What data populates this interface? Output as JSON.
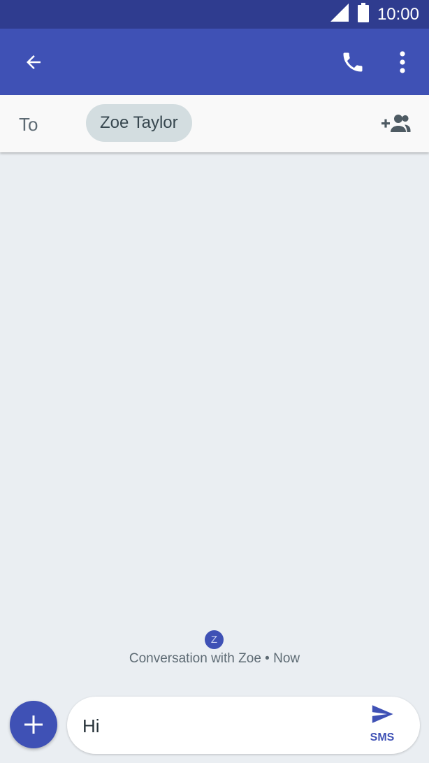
{
  "status_bar": {
    "time": "10:00",
    "signal_icon": "signal-icon",
    "battery_icon": "battery-icon"
  },
  "app_bar": {
    "background": "#3f51b5",
    "back_icon": "arrow-back-icon",
    "call_icon": "phone-icon",
    "menu_icon": "more-vert-icon"
  },
  "recipients": {
    "to_label": "To",
    "chips": [
      "Zoe Taylor"
    ],
    "add_icon": "add-person-icon"
  },
  "conversation": {
    "avatar_letter": "Z",
    "info": "Conversation with Zoe • Now"
  },
  "composer": {
    "attach_icon": "plus-icon",
    "text": "Hi",
    "send_icon": "send-icon",
    "send_label": "SMS"
  }
}
